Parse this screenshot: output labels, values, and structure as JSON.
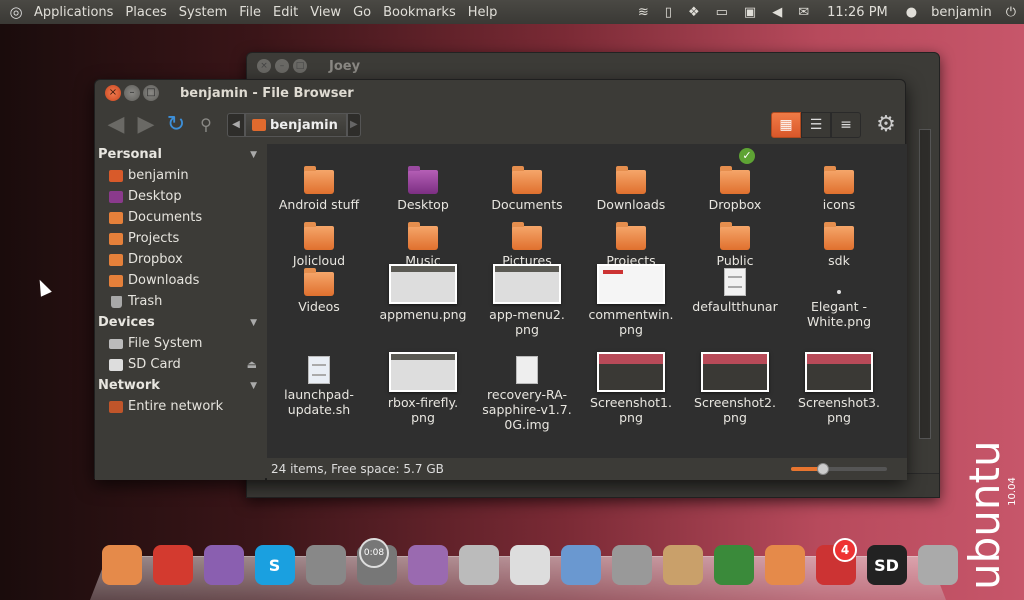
{
  "top_panel": {
    "menus": [
      "Applications",
      "Places",
      "System",
      "File",
      "Edit",
      "View",
      "Go",
      "Bookmarks",
      "Help"
    ],
    "clock": "11:26 PM",
    "user": "benjamin",
    "tray_icons": [
      "wifi-icon",
      "phone-icon",
      "dropbox-icon",
      "battery-icon",
      "monitor-icon",
      "volume-icon",
      "mail-icon"
    ]
  },
  "joey_window": {
    "title": "Joey"
  },
  "file_browser": {
    "title": "benjamin - File Browser",
    "breadcrumb": "benjamin",
    "sidebar": {
      "personal": {
        "header": "Personal",
        "items": [
          "benjamin",
          "Desktop",
          "Documents",
          "Projects",
          "Dropbox",
          "Downloads",
          "Trash"
        ]
      },
      "devices": {
        "header": "Devices",
        "items": [
          "File System",
          "SD Card"
        ]
      },
      "network": {
        "header": "Network",
        "items": [
          "Entire network"
        ]
      }
    },
    "files": [
      {
        "name": "Android stuff",
        "kind": "folder"
      },
      {
        "name": "Desktop",
        "kind": "folder-purple"
      },
      {
        "name": "Documents",
        "kind": "folder"
      },
      {
        "name": "Downloads",
        "kind": "folder"
      },
      {
        "name": "Dropbox",
        "kind": "folder-check"
      },
      {
        "name": "icons",
        "kind": "folder"
      },
      {
        "name": "Jolicloud",
        "kind": "folder"
      },
      {
        "name": "Music",
        "kind": "folder"
      },
      {
        "name": "Pictures",
        "kind": "folder"
      },
      {
        "name": "Projects",
        "kind": "folder"
      },
      {
        "name": "Public",
        "kind": "folder"
      },
      {
        "name": "sdk",
        "kind": "folder"
      },
      {
        "name": "Videos",
        "kind": "folder"
      },
      {
        "name": "appmenu.png",
        "kind": "thumb"
      },
      {
        "name": "app-menu2.\npng",
        "kind": "thumb"
      },
      {
        "name": "commentwin.\npng",
        "kind": "thumb-white"
      },
      {
        "name": "defaultthunar",
        "kind": "doc"
      },
      {
        "name": "Elegant -\nWhite.png",
        "kind": "dot"
      },
      {
        "name": "launchpad-\nupdate.sh",
        "kind": "doc-script"
      },
      {
        "name": "rbox-firefly.\npng",
        "kind": "thumb"
      },
      {
        "name": "recovery-RA-\nsapphire-v1.7.\n0G.img",
        "kind": "doc-bin"
      },
      {
        "name": "Screenshot1.\npng",
        "kind": "thumb-dark"
      },
      {
        "name": "Screenshot2.\npng",
        "kind": "thumb-dark"
      },
      {
        "name": "Screenshot3.\npng",
        "kind": "thumb-dark"
      }
    ],
    "status": "24 items, Free space: 5.7 GB",
    "zoom_level": 0.33
  },
  "dock": {
    "items": [
      {
        "name": "folder-app",
        "color": "#e58a4a",
        "glyph": ""
      },
      {
        "name": "chrome-app",
        "color": "#d33a2f",
        "glyph": ""
      },
      {
        "name": "pidgin-app",
        "color": "#8a5fb0",
        "glyph": ""
      },
      {
        "name": "skype-app",
        "color": "#1aa0e0",
        "glyph": "S"
      },
      {
        "name": "joystick-app",
        "color": "#888",
        "glyph": ""
      },
      {
        "name": "timer-app",
        "color": "#777",
        "glyph": ""
      },
      {
        "name": "empathy-app",
        "color": "#9a6ab0",
        "glyph": ""
      },
      {
        "name": "webcam-app",
        "color": "#bbb",
        "glyph": ""
      },
      {
        "name": "editor-app",
        "color": "#ddd",
        "glyph": ""
      },
      {
        "name": "writer-app",
        "color": "#6a98d0",
        "glyph": ""
      },
      {
        "name": "calculator-app",
        "color": "#999",
        "glyph": ""
      },
      {
        "name": "download-app",
        "color": "#c9a06a",
        "glyph": ""
      },
      {
        "name": "settings-app",
        "color": "#3a8a3a",
        "glyph": ""
      },
      {
        "name": "files-app",
        "color": "#e58a4a",
        "glyph": ""
      },
      {
        "name": "mail-app",
        "color": "#c33",
        "glyph": ""
      },
      {
        "name": "sd-app",
        "color": "#222",
        "glyph": "SD"
      },
      {
        "name": "trash-app",
        "color": "#aaa",
        "glyph": ""
      }
    ],
    "timer": "0:08",
    "mail_badge": "4"
  },
  "watermark": {
    "word": "ubuntu",
    "version": "10.04"
  }
}
